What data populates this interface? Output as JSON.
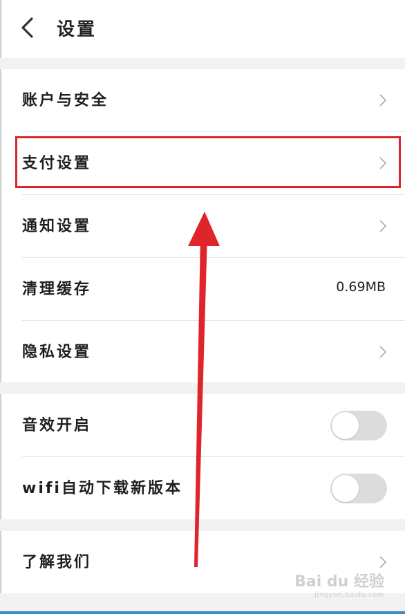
{
  "header": {
    "title": "设置"
  },
  "rows": {
    "account": "账户与安全",
    "payment": "支付设置",
    "notifications": "通知设置",
    "cache": "清理缓存",
    "cache_value": "0.69MB",
    "privacy": "隐私设置",
    "sound": "音效开启",
    "wifi_update": "wifi自动下载新版本",
    "about": "了解我们"
  },
  "toggles": {
    "sound_on": false,
    "wifi_update_on": false
  },
  "annotation": {
    "color": "#e0242c"
  },
  "watermark": {
    "brand": "Bai du 经验",
    "url": "jingyan.baidu.com"
  },
  "colors": {
    "background": "#f2f2f2",
    "toggle_off": "#dcdcdc",
    "bottom_bar": "#3f8dc3"
  }
}
